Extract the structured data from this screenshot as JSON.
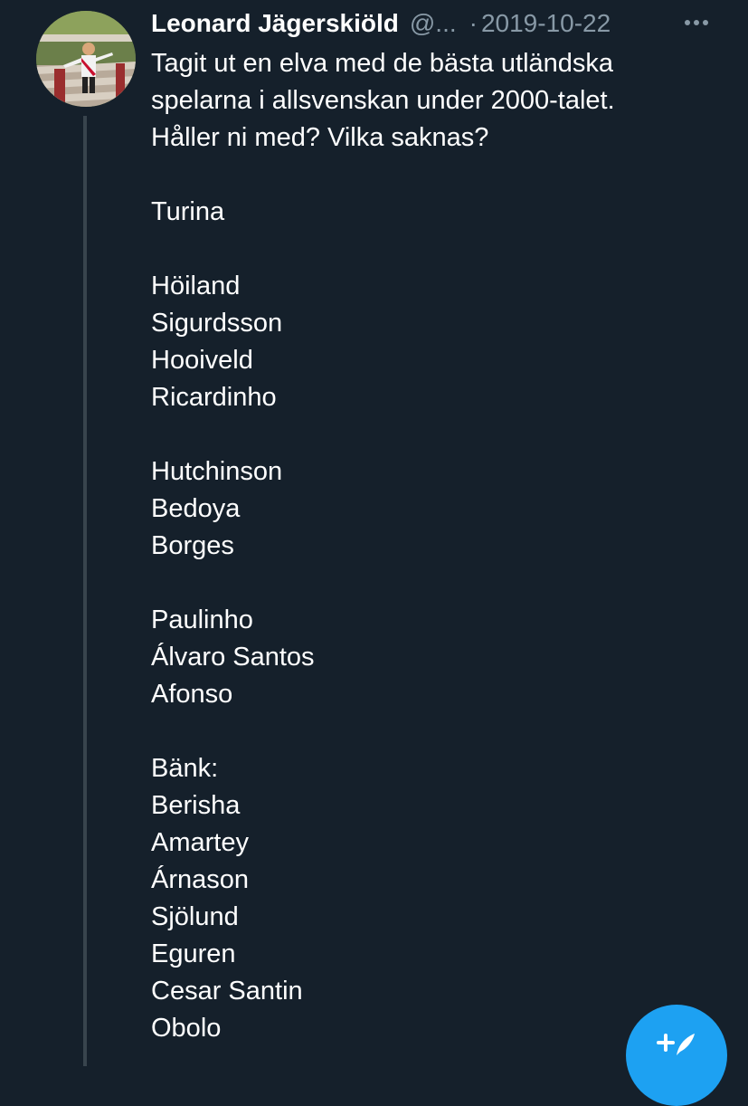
{
  "tweet": {
    "author_name": "Leonard Jägerskiöld",
    "handle": "@...",
    "separator": "·",
    "date": "2019-10-22",
    "more_icon": "more-horizontal-icon",
    "lines": [
      "Tagit ut en elva med de bästa utländska",
      "spelarna i allsvenskan under 2000-talet.",
      "Håller ni med? Vilka saknas?",
      "",
      "Turina",
      "",
      "Höiland",
      "Sigurdsson",
      "Hooiveld",
      "Ricardinho",
      "",
      "Hutchinson",
      "Bedoya",
      "Borges",
      "",
      "Paulinho",
      "Álvaro Santos",
      "Afonso",
      "",
      "Bänk:",
      "Berisha",
      "Amartey",
      "Árnason",
      "Sjölund",
      "Eguren",
      "Cesar Santin",
      "Obolo"
    ]
  },
  "compose_button": {
    "icon": "compose-tweet-icon",
    "color": "#1da1f2"
  },
  "theme": {
    "background": "#15202b",
    "text": "#ffffff",
    "secondary_text": "#8899a6",
    "thread_line": "#38444d"
  }
}
